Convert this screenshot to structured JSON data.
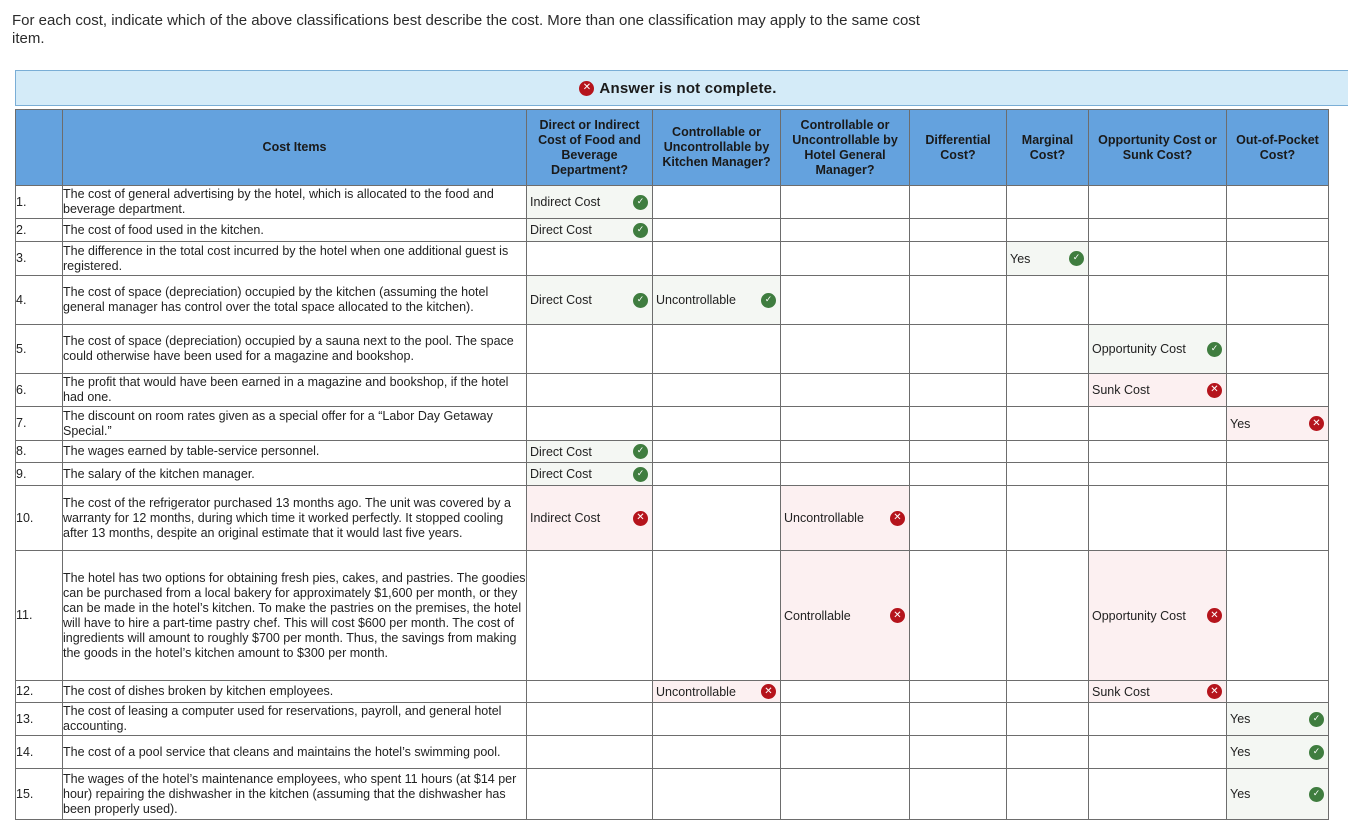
{
  "instructions": "For each cost, indicate which of the above classifications best describe the cost. More than one classification may apply to the same cost item.",
  "banner": {
    "icon": "x-circle-icon",
    "text": "Answer is not complete."
  },
  "status_colors": {
    "correct": "#3f7d3f",
    "incorrect": "#b5141c",
    "header_bg": "#64a2de",
    "banner_bg": "#d4ebf8"
  },
  "table": {
    "headers": [
      "",
      "Cost Items",
      "Direct or Indirect Cost of Food and Beverage Department?",
      "Controllable or Uncontrollable by Kitchen Manager?",
      "Controllable or Uncontrollable by Hotel General Manager?",
      "Differential Cost?",
      "Marginal Cost?",
      "Opportunity Cost or Sunk Cost?",
      "Out-of-Pocket Cost?"
    ],
    "rows": [
      {
        "num": "1.",
        "item": "The cost of general advertising by the hotel, which is allocated to the food and beverage department.",
        "answers": [
          {
            "value": "Indirect Cost",
            "status": "correct"
          },
          {
            "value": "",
            "status": ""
          },
          {
            "value": "",
            "status": ""
          },
          {
            "value": "",
            "status": ""
          },
          {
            "value": "",
            "status": ""
          },
          {
            "value": "",
            "status": ""
          },
          {
            "value": "",
            "status": ""
          }
        ]
      },
      {
        "num": "2.",
        "item": "The cost of food used in the kitchen.",
        "answers": [
          {
            "value": "Direct Cost",
            "status": "correct"
          },
          {
            "value": "",
            "status": ""
          },
          {
            "value": "",
            "status": ""
          },
          {
            "value": "",
            "status": ""
          },
          {
            "value": "",
            "status": ""
          },
          {
            "value": "",
            "status": ""
          },
          {
            "value": "",
            "status": ""
          }
        ]
      },
      {
        "num": "3.",
        "item": "The difference in the total cost incurred by the hotel when one additional guest is registered.",
        "answers": [
          {
            "value": "",
            "status": ""
          },
          {
            "value": "",
            "status": ""
          },
          {
            "value": "",
            "status": ""
          },
          {
            "value": "",
            "status": ""
          },
          {
            "value": "Yes",
            "status": "correct"
          },
          {
            "value": "",
            "status": ""
          },
          {
            "value": "",
            "status": ""
          }
        ]
      },
      {
        "num": "4.",
        "item": "The cost of space (depreciation) occupied by the kitchen (assuming the hotel general manager has control over the total space allocated to the kitchen).",
        "answers": [
          {
            "value": "Direct Cost",
            "status": "correct"
          },
          {
            "value": "Uncontrollable",
            "status": "correct"
          },
          {
            "value": "",
            "status": ""
          },
          {
            "value": "",
            "status": ""
          },
          {
            "value": "",
            "status": ""
          },
          {
            "value": "",
            "status": ""
          },
          {
            "value": "",
            "status": ""
          }
        ]
      },
      {
        "num": "5.",
        "item": "The cost of space (depreciation) occupied by a sauna next to the pool. The space could otherwise have been used for a magazine and bookshop.",
        "answers": [
          {
            "value": "",
            "status": ""
          },
          {
            "value": "",
            "status": ""
          },
          {
            "value": "",
            "status": ""
          },
          {
            "value": "",
            "status": ""
          },
          {
            "value": "",
            "status": ""
          },
          {
            "value": "Opportunity Cost",
            "status": "correct"
          },
          {
            "value": "",
            "status": ""
          }
        ]
      },
      {
        "num": "6.",
        "item": "The profit that would have been earned in a magazine and bookshop, if the hotel had one.",
        "answers": [
          {
            "value": "",
            "status": ""
          },
          {
            "value": "",
            "status": ""
          },
          {
            "value": "",
            "status": ""
          },
          {
            "value": "",
            "status": ""
          },
          {
            "value": "",
            "status": ""
          },
          {
            "value": "Sunk Cost",
            "status": "incorrect"
          },
          {
            "value": "",
            "status": ""
          }
        ]
      },
      {
        "num": "7.",
        "item": "The discount on room rates given as a special offer for a “Labor Day Getaway Special.”",
        "answers": [
          {
            "value": "",
            "status": ""
          },
          {
            "value": "",
            "status": ""
          },
          {
            "value": "",
            "status": ""
          },
          {
            "value": "",
            "status": ""
          },
          {
            "value": "",
            "status": ""
          },
          {
            "value": "",
            "status": ""
          },
          {
            "value": "Yes",
            "status": "incorrect"
          }
        ]
      },
      {
        "num": "8.",
        "item": "The wages earned by table-service personnel.",
        "answers": [
          {
            "value": "Direct Cost",
            "status": "correct"
          },
          {
            "value": "",
            "status": ""
          },
          {
            "value": "",
            "status": ""
          },
          {
            "value": "",
            "status": ""
          },
          {
            "value": "",
            "status": ""
          },
          {
            "value": "",
            "status": ""
          },
          {
            "value": "",
            "status": ""
          }
        ]
      },
      {
        "num": "9.",
        "item": "The salary of the kitchen manager.",
        "answers": [
          {
            "value": "Direct Cost",
            "status": "correct"
          },
          {
            "value": "",
            "status": ""
          },
          {
            "value": "",
            "status": ""
          },
          {
            "value": "",
            "status": ""
          },
          {
            "value": "",
            "status": ""
          },
          {
            "value": "",
            "status": ""
          },
          {
            "value": "",
            "status": ""
          }
        ]
      },
      {
        "num": "10.",
        "item": "The cost of the refrigerator purchased 13 months ago. The unit was covered by a warranty for 12 months, during which time it worked perfectly. It stopped cooling after 13 months, despite an original estimate that it would last five years.",
        "answers": [
          {
            "value": "Indirect Cost",
            "status": "incorrect"
          },
          {
            "value": "",
            "status": ""
          },
          {
            "value": "Uncontrollable",
            "status": "incorrect"
          },
          {
            "value": "",
            "status": ""
          },
          {
            "value": "",
            "status": ""
          },
          {
            "value": "",
            "status": ""
          },
          {
            "value": "",
            "status": ""
          }
        ]
      },
      {
        "num": "11.",
        "item": "The hotel has two options for obtaining fresh pies, cakes, and pastries. The goodies can be purchased from a local bakery for approximately $1,600 per month, or they can be made in the hotel’s kitchen. To make the pastries on the premises, the hotel will have to hire a part-time pastry chef. This will cost $600 per month. The cost of ingredients will amount to roughly $700 per month. Thus, the savings from making the goods in the hotel’s kitchen amount to $300 per month.",
        "answers": [
          {
            "value": "",
            "status": ""
          },
          {
            "value": "",
            "status": ""
          },
          {
            "value": "Controllable",
            "status": "incorrect"
          },
          {
            "value": "",
            "status": ""
          },
          {
            "value": "",
            "status": ""
          },
          {
            "value": "Opportunity Cost",
            "status": "incorrect"
          },
          {
            "value": "",
            "status": ""
          }
        ]
      },
      {
        "num": "12.",
        "item": "The cost of dishes broken by kitchen employees.",
        "answers": [
          {
            "value": "",
            "status": ""
          },
          {
            "value": "Uncontrollable",
            "status": "incorrect"
          },
          {
            "value": "",
            "status": ""
          },
          {
            "value": "",
            "status": ""
          },
          {
            "value": "",
            "status": ""
          },
          {
            "value": "Sunk Cost",
            "status": "incorrect"
          },
          {
            "value": "",
            "status": ""
          }
        ]
      },
      {
        "num": "13.",
        "item": "The cost of leasing a computer used for reservations, payroll, and general hotel accounting.",
        "answers": [
          {
            "value": "",
            "status": ""
          },
          {
            "value": "",
            "status": ""
          },
          {
            "value": "",
            "status": ""
          },
          {
            "value": "",
            "status": ""
          },
          {
            "value": "",
            "status": ""
          },
          {
            "value": "",
            "status": ""
          },
          {
            "value": "Yes",
            "status": "correct"
          }
        ]
      },
      {
        "num": "14.",
        "item": "The cost of a pool service that cleans and maintains the hotel’s swimming pool.",
        "answers": [
          {
            "value": "",
            "status": ""
          },
          {
            "value": "",
            "status": ""
          },
          {
            "value": "",
            "status": ""
          },
          {
            "value": "",
            "status": ""
          },
          {
            "value": "",
            "status": ""
          },
          {
            "value": "",
            "status": ""
          },
          {
            "value": "Yes",
            "status": "correct"
          }
        ]
      },
      {
        "num": "15.",
        "item": "The wages of the hotel’s maintenance employees, who spent 11 hours (at $14 per hour) repairing the dishwasher in the kitchen (assuming that the dishwasher has been properly used).",
        "answers": [
          {
            "value": "",
            "status": ""
          },
          {
            "value": "",
            "status": ""
          },
          {
            "value": "",
            "status": ""
          },
          {
            "value": "",
            "status": ""
          },
          {
            "value": "",
            "status": ""
          },
          {
            "value": "",
            "status": ""
          },
          {
            "value": "Yes",
            "status": "correct"
          }
        ]
      }
    ]
  }
}
